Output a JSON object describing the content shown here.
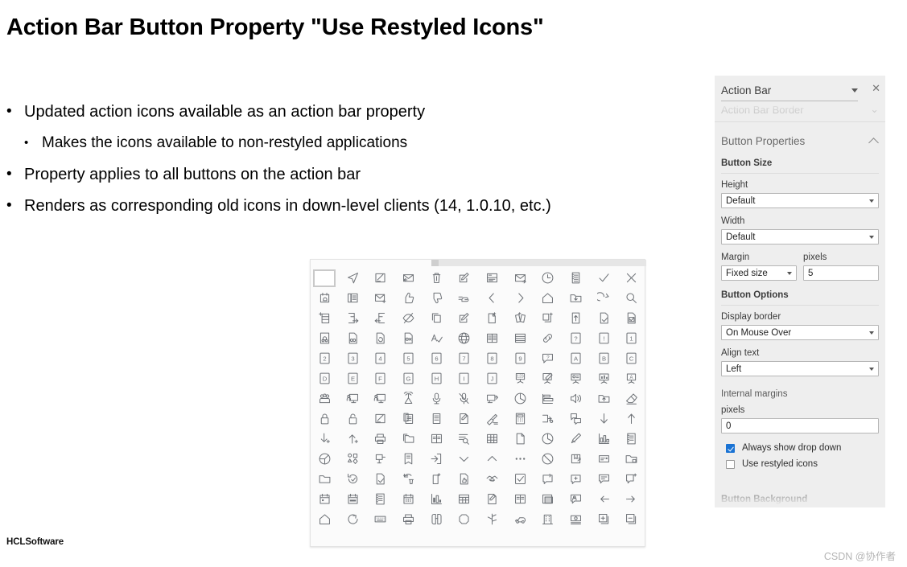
{
  "slide": {
    "title": "Action Bar Button Property \"Use Restyled Icons\"",
    "bullets": [
      {
        "level": 1,
        "marker": "•",
        "text": "Updated action icons available as an action bar property"
      },
      {
        "level": 2,
        "marker": "•",
        "text": "Makes the icons available to non-restyled applications"
      },
      {
        "level": 1,
        "marker": "•",
        "text": "Property applies to all buttons on the action bar"
      },
      {
        "level": 1,
        "marker": "•",
        "text": "Renders as corresponding old icons in down-level clients (14, 1.0.10, etc.)"
      }
    ],
    "footer_logo": "HCLSoftware",
    "watermark": "CSDN @协作者"
  },
  "icon_palette": {
    "columns": 12,
    "rows": 14,
    "selected_index": 0,
    "icons": [
      "blank-square-icon",
      "send-paperplane-icon",
      "compose-signed-icon",
      "reply-mail-icon",
      "delete-trash-icon",
      "edit-pencil-square-icon",
      "split-view-icon",
      "forward-mail-icon",
      "clock-icon",
      "list-document-icon",
      "checkmark-icon",
      "close-x-icon",
      "alarm-calendar-icon",
      "phone-directory-icon",
      "new-mail-icon",
      "thumbs-up-icon",
      "thumbs-down-icon",
      "pointing-hand-icon",
      "chevron-left-icon",
      "chevron-right-icon",
      "home-icon",
      "folder-move-in-icon",
      "redo-arrow-icon",
      "search-magnifier-icon",
      "add-to-list-icon",
      "export-right-icon",
      "import-left-icon",
      "hide-eye-icon",
      "copy-icon",
      "edit-document-icon",
      "new-document-icon",
      "archive-books-icon",
      "duplicate-add-icon",
      "upload-document-icon",
      "approve-document-icon",
      "verify-document-icon",
      "document-bell-icon",
      "document-link-icon",
      "document-refresh-icon",
      "document-review-icon",
      "spell-check-icon",
      "globe-icon",
      "two-column-icon",
      "rows-list-icon",
      "link-chain-icon",
      "help-question-icon",
      "alert-exclamation-icon",
      "key-1-icon",
      "key-2-icon",
      "key-3-icon",
      "key-4-icon",
      "key-5-icon",
      "key-6-icon",
      "key-7-icon",
      "key-8-icon",
      "key-9-icon",
      "question-bubble-icon",
      "key-a-icon",
      "key-b-icon",
      "key-c-icon",
      "key-d-icon",
      "key-e-icon",
      "key-f-icon",
      "key-g-icon",
      "key-h-icon",
      "key-i-icon",
      "key-j-icon",
      "numbered-presentation-icon",
      "presentation-edit-icon",
      "presentation-screen-icon",
      "presentation-chart-icon",
      "presentation-text-icon",
      "people-group-icon",
      "presenter-screen-icon",
      "monitor-person-icon",
      "broadcast-icon",
      "microphone-icon",
      "mic-muted-icon",
      "projector-icon",
      "pie-chart-icon",
      "bar-chart-icon",
      "speaker-volume-icon",
      "folder-upload-icon",
      "eraser-icon",
      "lock-closed-icon",
      "lock-open-icon",
      "compose-edit-icon",
      "clipboard-list-icon",
      "database-icon",
      "signature-doc-icon",
      "clean-brush-icon",
      "calculator-icon",
      "assign-user-icon",
      "comment-move-icon",
      "arrow-down-icon",
      "arrow-up-icon",
      "download-add-icon",
      "upload-add-icon",
      "print-icon",
      "copy-folder-icon",
      "book-open-icon",
      "search-list-icon",
      "table-grid-icon",
      "file-page-icon",
      "pie-slice-icon",
      "pencils-icon",
      "bar-graph-icon",
      "notebook-icon",
      "pie-3d-icon",
      "shapes-group-icon",
      "pin-board-icon",
      "book-closed-icon",
      "exit-door-icon",
      "chevron-down-icon",
      "chevron-up-icon",
      "ellipsis-more-icon",
      "block-circle-icon",
      "book-mark-icon",
      "business-card-icon",
      "folder-lock-icon",
      "folder-icon",
      "refresh-check-icon",
      "file-check-icon",
      "restore-trash-icon",
      "add-page-icon",
      "file-thumbs-icon",
      "handshake-icon",
      "checkbox-checked-icon",
      "bubble-loop-icon",
      "bubble-add-icon",
      "bubble-text-icon",
      "bubble-new-icon",
      "calendar-day-icon",
      "calendar-week-icon",
      "notepad-icon",
      "calendar-month-icon",
      "bar-stats-icon",
      "table-columns-icon",
      "edit-note-icon",
      "book-pages-icon",
      "window-fill-icon",
      "contact-bubble-icon",
      "arrow-back-dot-icon",
      "arrow-forward-dot-icon",
      "home-outline-icon",
      "refresh-circle-icon",
      "keyboard-icon",
      "printer-icon",
      "binoculars-icon",
      "octagon-icon",
      "network-node-icon",
      "car-icon",
      "building-icon",
      "banknote-icon",
      "add-box-icon",
      "remove-box-icon"
    ]
  },
  "properties_panel": {
    "title": "Action Bar",
    "close_label": "✕",
    "faded_top_label": "Action Bar Border",
    "section": {
      "label": "Button Properties",
      "groups": [
        {
          "label": "Button Size",
          "fields": [
            {
              "label": "Height",
              "type": "select",
              "value": "Default"
            },
            {
              "label": "Width",
              "type": "select",
              "value": "Default"
            }
          ],
          "inline_fields": [
            {
              "label": "Margin",
              "type": "select",
              "value": "Fixed size"
            },
            {
              "label": "pixels",
              "type": "text",
              "value": "5"
            }
          ]
        },
        {
          "label": "Button Options",
          "fields": [
            {
              "label": "Display border",
              "type": "select",
              "value": "On Mouse Over"
            },
            {
              "label": "Align text",
              "type": "select",
              "value": "Left"
            },
            {
              "label": "Internal margins",
              "type": "static",
              "value": ""
            },
            {
              "label": "pixels",
              "type": "text",
              "value": "0"
            }
          ],
          "checkboxes": [
            {
              "label": "Always show drop down",
              "checked": true
            },
            {
              "label": "Use restyled icons",
              "checked": false
            }
          ]
        }
      ]
    },
    "faded_bottom_label": "Button Background",
    "accent_color": "#1a73d4",
    "panel_background": "#eeeeee"
  }
}
